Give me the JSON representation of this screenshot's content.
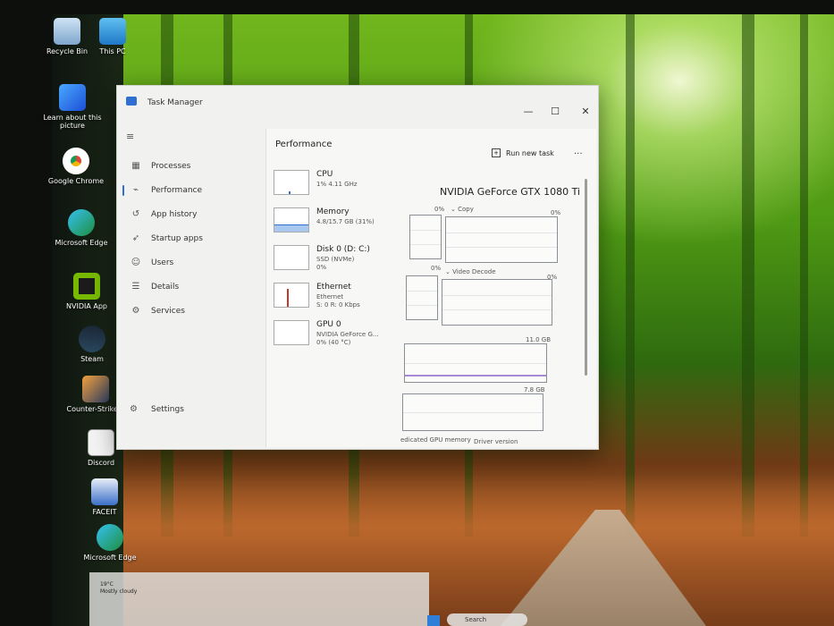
{
  "desktop": {
    "icons": [
      {
        "label": "Recycle Bin",
        "icon": "recycle-bin-icon"
      },
      {
        "label": "This PC",
        "icon": "computer-icon"
      },
      {
        "label": "Learn about this picture",
        "icon": "learn-picture-icon"
      },
      {
        "label": "Google Chrome",
        "icon": "chrome-icon"
      },
      {
        "label": "Microsoft Edge",
        "icon": "edge-icon"
      },
      {
        "label": "NVIDIA App",
        "icon": "nvidia-icon"
      },
      {
        "label": "Steam",
        "icon": "steam-icon"
      },
      {
        "label": "Counter-Strike 2",
        "icon": "counter-strike-icon"
      },
      {
        "label": "Discord",
        "icon": "discord-icon"
      },
      {
        "label": "FACEIT",
        "icon": "faceit-icon"
      },
      {
        "label": "Microsoft Edge",
        "icon": "edge-icon"
      }
    ]
  },
  "window": {
    "title": "Task Manager",
    "minimize": "—",
    "maximize": "☐",
    "close": "✕"
  },
  "nav": {
    "menu_icon": "≡",
    "items": [
      {
        "label": "Processes",
        "icon": "processes-icon"
      },
      {
        "label": "Performance",
        "icon": "performance-icon"
      },
      {
        "label": "App history",
        "icon": "app-history-icon"
      },
      {
        "label": "Startup apps",
        "icon": "startup-apps-icon"
      },
      {
        "label": "Users",
        "icon": "users-icon"
      },
      {
        "label": "Details",
        "icon": "details-icon"
      },
      {
        "label": "Services",
        "icon": "services-icon"
      }
    ],
    "settings_label": "Settings"
  },
  "performance": {
    "title": "Performance",
    "run_task_label": "Run new task",
    "more_label": "...",
    "resources": [
      {
        "name": "CPU",
        "line1": "1% 4.11 GHz",
        "line2": ""
      },
      {
        "name": "Memory",
        "line1": "4.8/15.7 GB (31%)",
        "line2": ""
      },
      {
        "name": "Disk 0 (D: C:)",
        "line1": "SSD (NVMe)",
        "line2": "0%"
      },
      {
        "name": "Ethernet",
        "line1": "Ethernet",
        "line2": "S: 0 R: 0 Kbps"
      },
      {
        "name": "GPU 0",
        "line1": "NVIDIA GeForce G...",
        "line2": "0% (40 °C)"
      }
    ],
    "gpu_name": "NVIDIA GeForce GTX 1080 Ti",
    "graphs": {
      "top_left_pct": "0%",
      "copy_label": "⌄ Copy",
      "copy_pct": "0%",
      "row2_left_pct": "0%",
      "video_decode_label": "⌄ Video Decode",
      "video_decode_pct": "0%",
      "dedicated_max": "11.0 GB",
      "shared_max": "7.8 GB",
      "footer_left": "edicated GPU memory",
      "footer_right": "Driver version"
    }
  },
  "taskbar": {
    "weather_temp": "19°C",
    "weather_desc": "Mostly cloudy",
    "search_label": "Search"
  },
  "colors": {
    "accent": "#2f6fd1",
    "memory_line": "#a889d4",
    "ethernet_spike": "#c0392b"
  }
}
